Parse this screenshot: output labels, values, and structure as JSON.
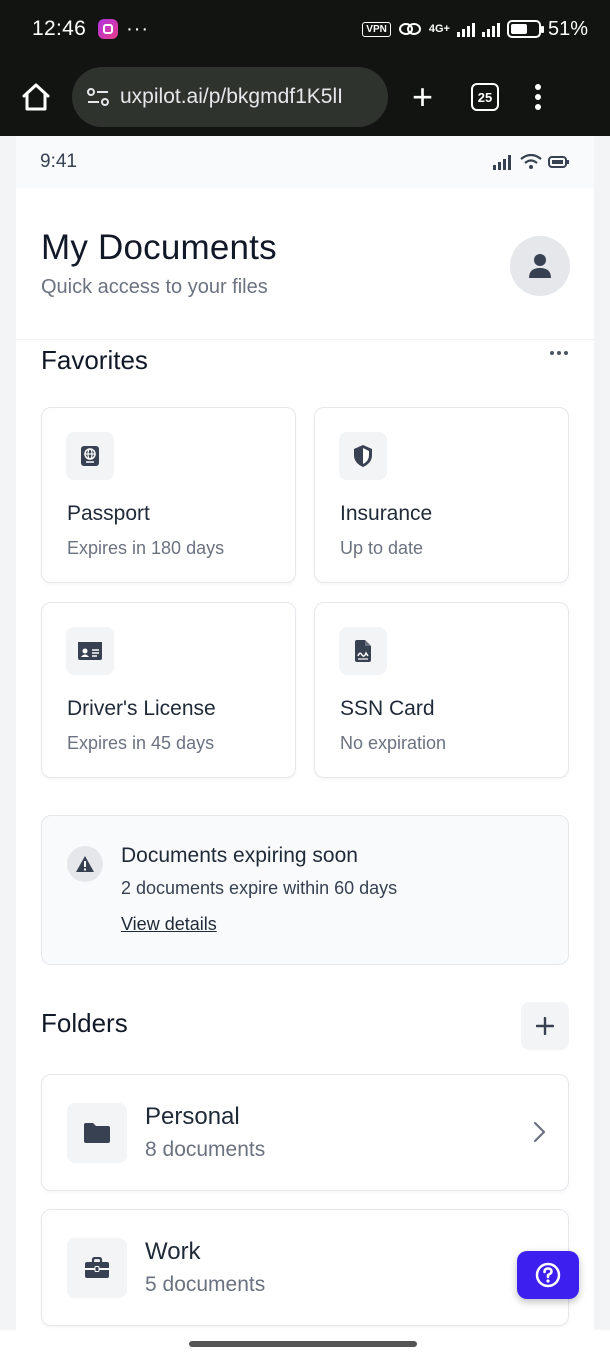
{
  "system": {
    "time": "12:46",
    "dots": "···",
    "vpn": "VPN",
    "network": "4G+",
    "battery": "51%"
  },
  "browser": {
    "url": "uxpilot.ai/p/bkgmdf1K5lI",
    "tab_count": "25"
  },
  "mock_status": {
    "time": "9:41"
  },
  "header": {
    "title": "My Documents",
    "subtitle": "Quick access to your files"
  },
  "favorites": {
    "title": "Favorites",
    "items": [
      {
        "title": "Passport",
        "subtitle": "Expires in 180 days",
        "icon": "passport-icon"
      },
      {
        "title": "Insurance",
        "subtitle": "Up to date",
        "icon": "shield-icon"
      },
      {
        "title": "Driver's License",
        "subtitle": "Expires in 45 days",
        "icon": "id-card-icon"
      },
      {
        "title": "SSN Card",
        "subtitle": "No expiration",
        "icon": "file-signature-icon"
      }
    ]
  },
  "alert": {
    "title": "Documents expiring soon",
    "message": "2 documents expire within 60 days",
    "link": "View details"
  },
  "folders": {
    "title": "Folders",
    "items": [
      {
        "name": "Personal",
        "count": "8 documents",
        "icon": "folder-icon"
      },
      {
        "name": "Work",
        "count": "5 documents",
        "icon": "briefcase-icon"
      }
    ]
  },
  "colors": {
    "accent": "#3d1ff0",
    "icon": "#374151",
    "text_primary": "#1f2937",
    "text_secondary": "#6b7280"
  }
}
